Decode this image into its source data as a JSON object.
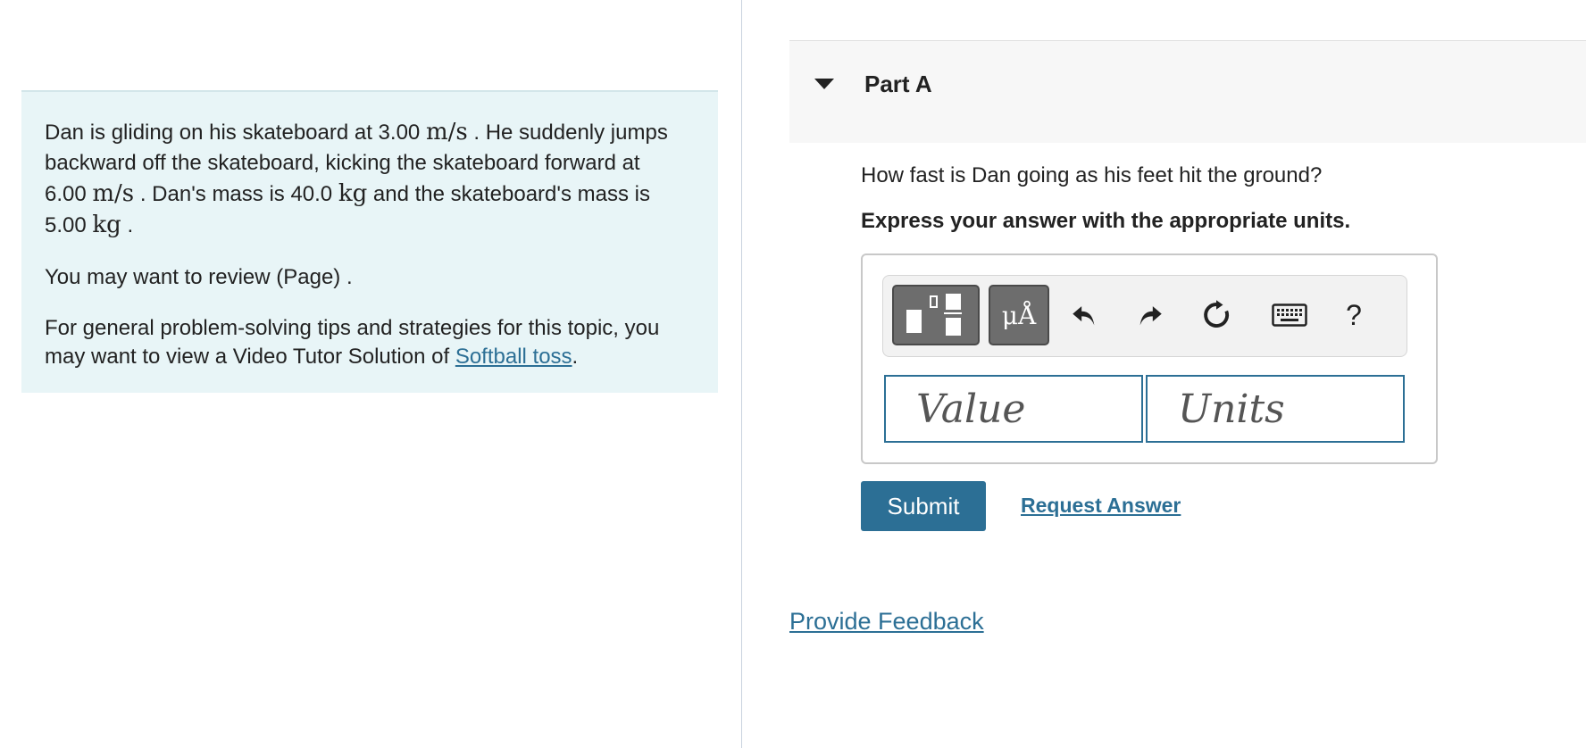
{
  "problem": {
    "paragraph1": [
      "Dan is gliding on his skateboard at 3.00 ",
      "m/s",
      " . He suddenly jumps backward off the skateboard, kicking the skateboard forward at 6.00 ",
      "m/s",
      " . Dan's mass is 40.0 ",
      "kg",
      " and the skateboard's mass is 5.00 ",
      "kg",
      " ."
    ],
    "paragraph2": "You may want to review (Page) .",
    "paragraph3_text": "For general problem-solving tips and strategies for this topic, you may want to view a Video Tutor Solution of ",
    "paragraph3_link": "Softball toss",
    "paragraph3_end": "."
  },
  "part": {
    "title": "Part A",
    "question": "How fast is Dan going as his feet hit the ground?",
    "instruction": "Express your answer with the appropriate units."
  },
  "toolbar": {
    "units_button_label": "μÅ",
    "help_label": "?",
    "icons": [
      "templates-icon",
      "undo-icon",
      "redo-icon",
      "reset-icon",
      "keyboard-icon",
      "help-icon"
    ]
  },
  "inputs": {
    "value_placeholder": "Value",
    "units_placeholder": "Units"
  },
  "actions": {
    "submit": "Submit",
    "request_answer": "Request Answer",
    "provide_feedback": "Provide Feedback"
  },
  "colors": {
    "accent": "#2c6f95",
    "problem_bg": "#e8f5f7"
  }
}
